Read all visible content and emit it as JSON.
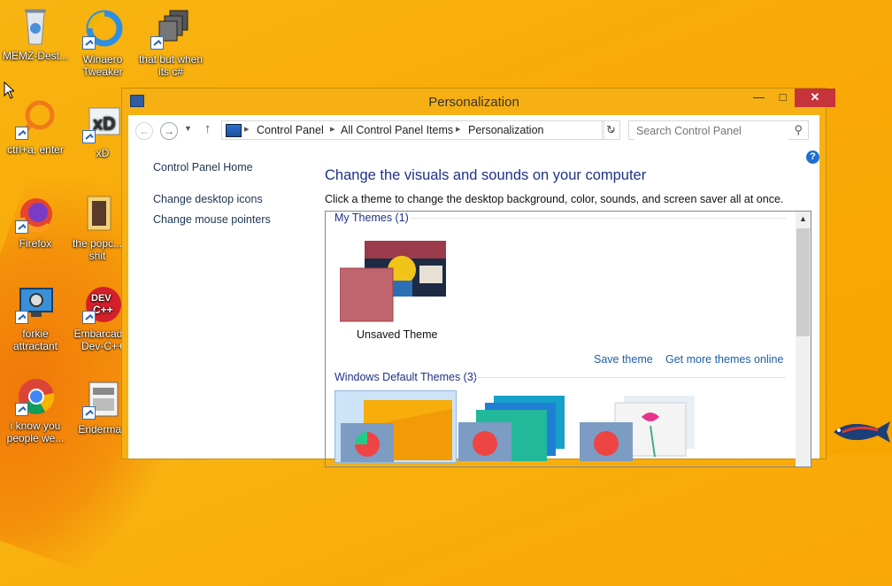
{
  "desktop": {
    "icons": [
      {
        "label": "MEMZ-Dest...",
        "icon": "recycle-bin-icon"
      },
      {
        "label": "Winaero Tweaker",
        "icon": "winaero-tweaker-icon"
      },
      {
        "label": "that but when its c#",
        "icon": "stacked-windows-icon"
      },
      {
        "label": "ctrl+a, enter",
        "icon": "magnifier-icon"
      },
      {
        "label": "xD",
        "icon": "hxd-icon"
      },
      {
        "label": "Firefox",
        "icon": "firefox-icon"
      },
      {
        "label": "the popc... shit",
        "icon": "folder-icon"
      },
      {
        "label": "forkie attractant",
        "icon": "computer-gear-icon"
      },
      {
        "label": "Embarcad... Dev-C++",
        "icon": "devcpp-icon"
      },
      {
        "label": "i know you people we...",
        "icon": "chrome-icon"
      },
      {
        "label": "Enderman",
        "icon": "document-icon"
      }
    ]
  },
  "window": {
    "title": "Personalization",
    "controls": {
      "minimize": "—",
      "maximize": "□",
      "close": "✕"
    },
    "address": {
      "crumbs": [
        "Control Panel",
        "All Control Panel Items",
        "Personalization"
      ],
      "separator": "▸"
    },
    "search": {
      "placeholder": "Search Control Panel"
    },
    "left_pane": {
      "home": "Control Panel Home",
      "links": [
        "Change desktop icons",
        "Change mouse pointers"
      ]
    },
    "main": {
      "heading": "Change the visuals and sounds on your computer",
      "subtitle": "Click a theme to change the desktop background, color, sounds, and screen saver all at once.",
      "my_themes": {
        "label": "My Themes (1)",
        "items": [
          {
            "name": "Unsaved Theme",
            "tile_color": "#c0646d"
          }
        ],
        "actions": [
          "Save theme",
          "Get more themes online"
        ]
      },
      "default_themes": {
        "label": "Windows Default Themes (3)"
      }
    }
  },
  "colors": {
    "desktop": "#f7ab07",
    "close_button": "#c7333a",
    "link": "#1e3287",
    "accent": "#1d5fa8"
  }
}
